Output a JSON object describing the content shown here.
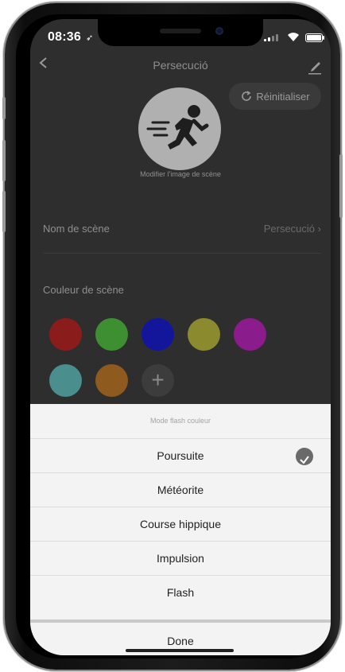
{
  "status_bar": {
    "time": "08:36",
    "location_glyph": "➶"
  },
  "nav": {
    "title": "Persecució"
  },
  "scene_editor": {
    "reset_label": "Réinitialiser",
    "modify_image_label": "Modifier l'image de scène",
    "name_label": "Nom de scène",
    "name_value": "Persecució",
    "name_chevron": "›",
    "color_label": "Couleur de scène",
    "colors": [
      "#8a1c1c",
      "#3e8e32",
      "#13169a",
      "#8c8a2e",
      "#8a1c8c",
      "#4a8e8e",
      "#8e5a1e"
    ],
    "add_symbol": "+"
  },
  "flash_sheet": {
    "title": "Mode flash couleur",
    "options": [
      {
        "label": "Poursuite",
        "selected": true
      },
      {
        "label": "Météorite",
        "selected": false
      },
      {
        "label": "Course hippique",
        "selected": false
      },
      {
        "label": "Impulsion",
        "selected": false
      },
      {
        "label": "Flash",
        "selected": false
      }
    ],
    "done_label": "Done"
  }
}
